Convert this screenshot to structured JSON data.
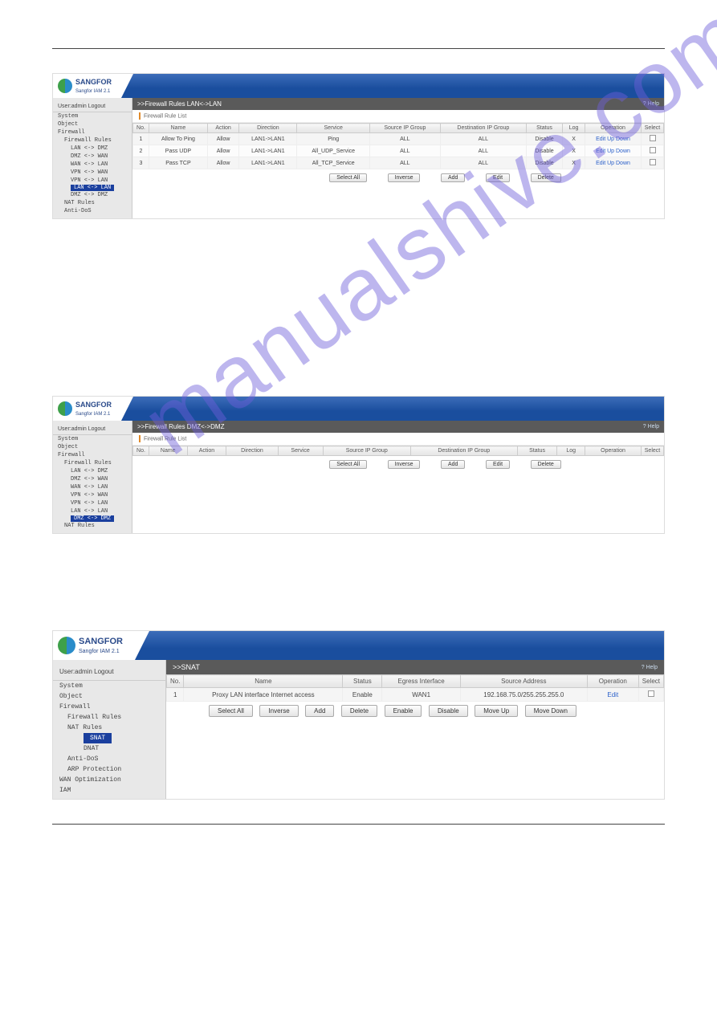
{
  "brand": {
    "name": "SANGFOR",
    "sub": "Sangfor IAM 2.1"
  },
  "userbar": "User:admin  Logout",
  "help_label": "Help",
  "listhdr": "Firewall Rule List",
  "tree": {
    "system": "System",
    "object": "Object",
    "firewall": "Firewall",
    "rules": "Firewall Rules",
    "lan_dmz": "LAN <-> DMZ",
    "dmz_wan": "DMZ <-> WAN",
    "wan_lan": "WAN <-> LAN",
    "vpn_wan": "VPN <-> WAN",
    "vpn_lan": "VPN <-> LAN",
    "lan_lan": "LAN <-> LAN",
    "dmz_dmz": "DMZ <-> DMZ",
    "nat": "NAT Rules",
    "anti": "Anti-DoS",
    "snat": "SNAT",
    "dnat": "DNAT",
    "arp": "ARP Protection",
    "wanopt": "WAN Optimization",
    "iam": "IAM"
  },
  "panel1": {
    "title": ">>Firewall Rules LAN<->LAN",
    "cols": [
      "No.",
      "Name",
      "Action",
      "Direction",
      "Service",
      "Source IP Group",
      "Destination IP Group",
      "Status",
      "Log",
      "Operation",
      "Select"
    ],
    "rows": [
      {
        "no": "1",
        "name": "Allow To Ping",
        "action": "Allow",
        "dir": "LAN1->LAN1",
        "svc": "Ping",
        "src": "ALL",
        "dst": "ALL",
        "status": "Disable",
        "log": "X"
      },
      {
        "no": "2",
        "name": "Pass UDP",
        "action": "Allow",
        "dir": "LAN1->LAN1",
        "svc": "All_UDP_Service",
        "src": "ALL",
        "dst": "ALL",
        "status": "Disable",
        "log": "X"
      },
      {
        "no": "3",
        "name": "Pass TCP",
        "action": "Allow",
        "dir": "LAN1->LAN1",
        "svc": "All_TCP_Service",
        "src": "ALL",
        "dst": "ALL",
        "status": "Disable",
        "log": "X"
      }
    ],
    "ops": {
      "edit": "Edit",
      "up": "Up",
      "down": "Down"
    }
  },
  "panel2": {
    "title": ">>Firewall Rules DMZ<->DMZ",
    "cols": [
      "No.",
      "Name",
      "Action",
      "Direction",
      "Service",
      "Source IP Group",
      "Destination IP Group",
      "Status",
      "Log",
      "Operation",
      "Select"
    ]
  },
  "panel3": {
    "title": ">>SNAT",
    "cols": [
      "No.",
      "Name",
      "Status",
      "Egress Interface",
      "Source Address",
      "Operation",
      "Select"
    ],
    "row": {
      "no": "1",
      "name": "Proxy LAN interface Internet access",
      "status": "Enable",
      "egress": "WAN1",
      "src": "192.168.75.0/255.255.255.0",
      "op": "Edit"
    }
  },
  "btns": {
    "selectall": "Select All",
    "inverse": "Inverse",
    "add": "Add",
    "edit": "Edit",
    "delete": "Delete",
    "enable": "Enable",
    "disable": "Disable",
    "moveup": "Move Up",
    "movedown": "Move Down"
  },
  "watermark": "manualshive.com"
}
